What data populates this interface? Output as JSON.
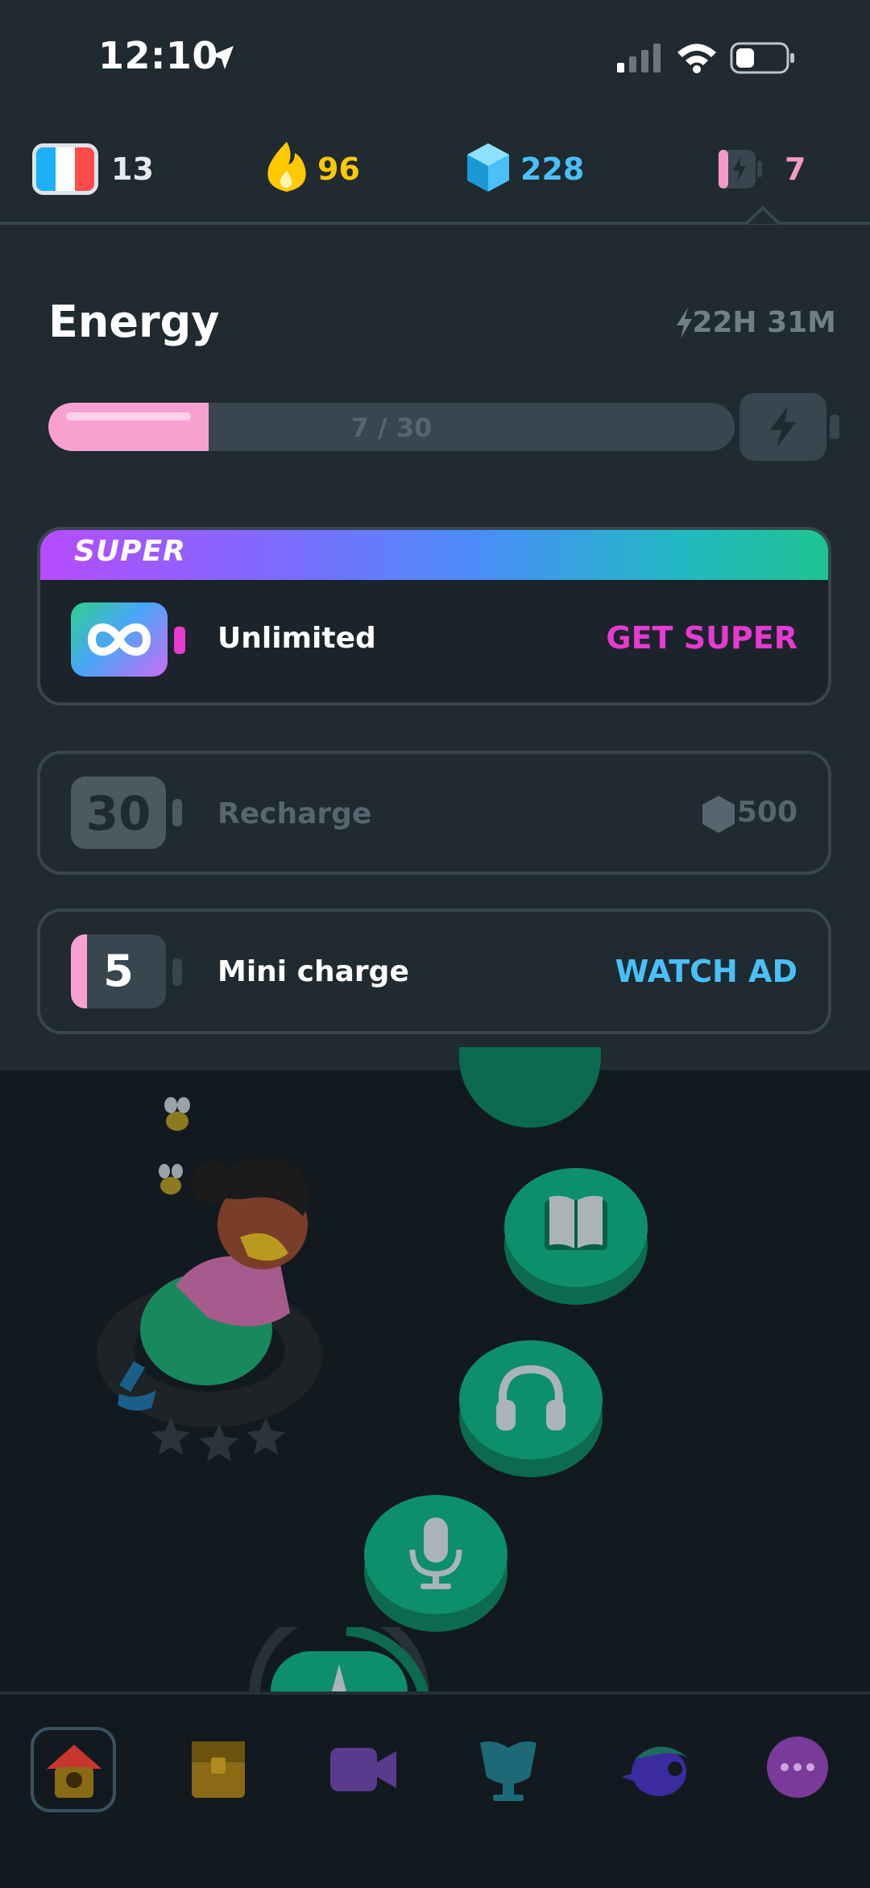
{
  "status_bar": {
    "time": "12:10",
    "icons": [
      "location-arrow-icon",
      "cellular-signal-icon",
      "wifi-icon",
      "battery-icon"
    ]
  },
  "header": {
    "course": {
      "icon": "france-flag-icon",
      "value": "13"
    },
    "streak": {
      "icon": "flame-icon",
      "value": "96",
      "color": "#ffc800"
    },
    "gems": {
      "icon": "gem-icon",
      "value": "228",
      "color": "#49c0f8"
    },
    "energy": {
      "icon": "energy-battery-icon",
      "value": "7",
      "color": "#f49ac8"
    }
  },
  "energy_panel": {
    "title": "Energy",
    "refill_timer": "22H 31M",
    "current": 7,
    "max": 30,
    "progress_label": "7 / 30",
    "super_card": {
      "badge": "SUPER",
      "label": "Unlimited",
      "action": "GET SUPER",
      "action_color": "#e63ad1"
    },
    "recharge_card": {
      "amount": "30",
      "label": "Recharge",
      "cost": "500"
    },
    "mini_card": {
      "amount": "5",
      "label": "Mini charge",
      "action": "WATCH AD",
      "action_color": "#49c0f8"
    }
  },
  "path": {
    "nodes": [
      "lesson-node",
      "book-node",
      "headphones-node",
      "microphone-node",
      "current-node"
    ],
    "stars_earned": 0,
    "stars_total": 3
  },
  "tab_bar": {
    "tabs": [
      "home-tab",
      "chest-tab",
      "video-tab",
      "league-tab",
      "profile-tab",
      "more-tab"
    ],
    "active": "home-tab"
  },
  "colors": {
    "panel": "#1f2a31",
    "background": "#121a20",
    "node_green": "#0e8f6c",
    "energy_pink": "#f8a1d0"
  }
}
